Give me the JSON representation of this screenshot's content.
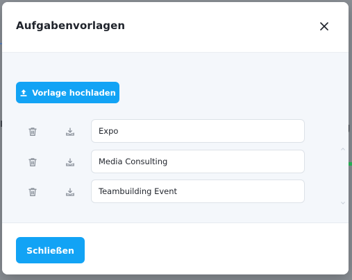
{
  "backdrop": {
    "left_fragment": "n",
    "right_fragment": "g"
  },
  "modal": {
    "title": "Aufgabenvorlagen",
    "close_icon": "close-icon",
    "upload_button": {
      "label": "Vorlage hochladen",
      "icon": "upload-icon"
    },
    "templates": [
      {
        "name": "Expo"
      },
      {
        "name": "Media Consulting"
      },
      {
        "name": "Teambuilding Event"
      }
    ],
    "footer_button": "Schließen"
  },
  "colors": {
    "primary": "#12a3f5",
    "body_bg": "#f4f7fb",
    "text": "#1f232b",
    "icon": "#8a919b"
  }
}
